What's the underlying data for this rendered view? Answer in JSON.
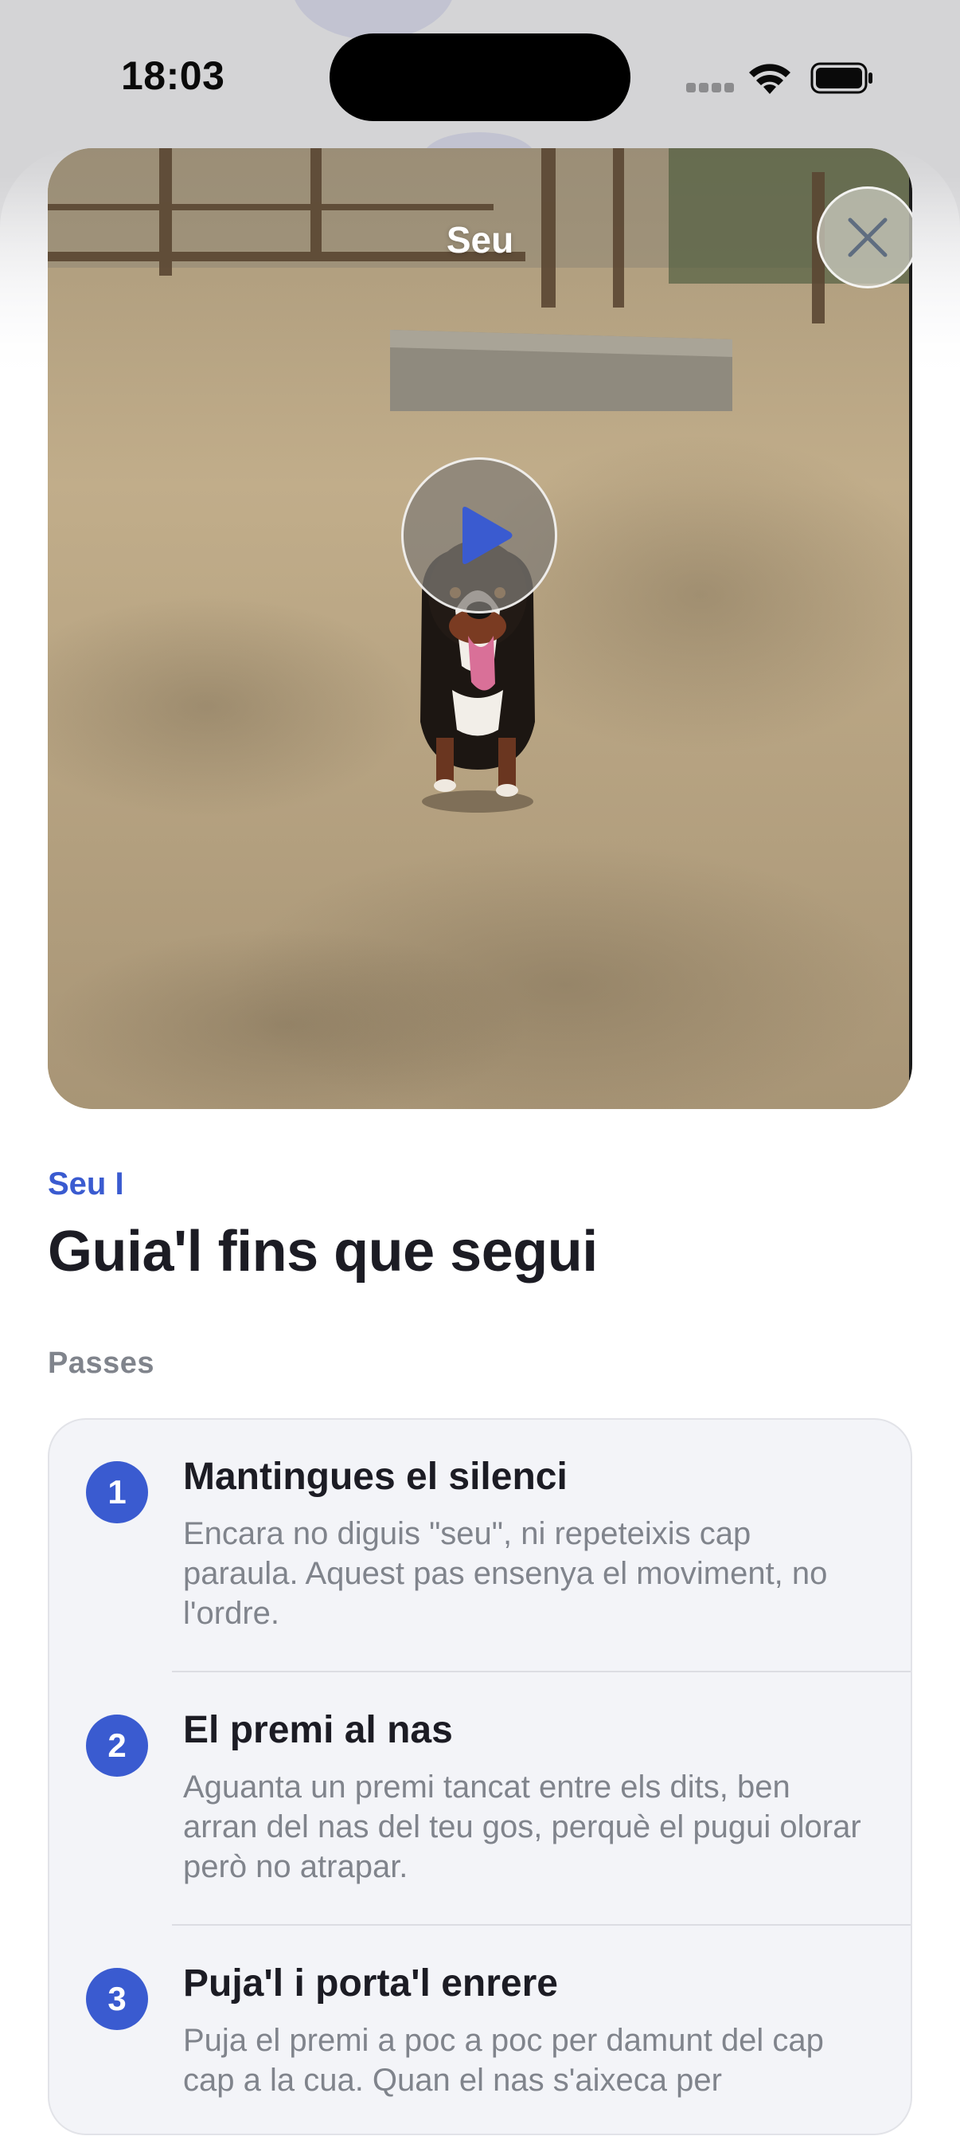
{
  "status_bar": {
    "time": "18:03"
  },
  "video": {
    "title": "Seu",
    "close_icon": "close-icon",
    "play_icon": "play-icon",
    "accent_color": "#3a5bd0"
  },
  "lesson": {
    "category": "Seu I",
    "title": "Guia'l fins que segui",
    "steps_label": "Passes",
    "steps": [
      {
        "number": "1",
        "title": "Mantingues el silenci",
        "description": "Encara no diguis \"seu\", ni repeteixis cap paraula. Aquest pas ensenya el moviment, no l'ordre."
      },
      {
        "number": "2",
        "title": "El premi al nas",
        "description": "Aguanta un premi tancat entre els dits, ben arran del nas del teu gos, perquè el pugui olorar però no atrapar."
      },
      {
        "number": "3",
        "title": "Puja'l i porta'l enrere",
        "description": "Puja el premi a poc a poc per damunt del cap cap a la cua. Quan el nas s'aixeca per"
      }
    ]
  }
}
